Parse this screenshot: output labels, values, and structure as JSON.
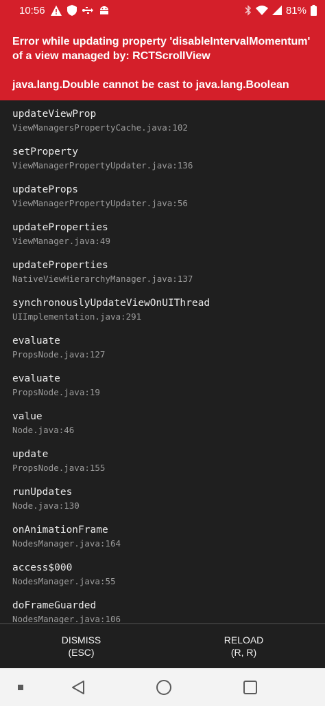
{
  "status_bar": {
    "time": "10:56",
    "battery_percent": "81%",
    "left_icons": [
      "warning-icon",
      "shield-icon",
      "usb-icon",
      "android-debug-icon"
    ],
    "right_icons": [
      "bluetooth-icon",
      "wifi-icon",
      "signal-icon",
      "battery-icon"
    ],
    "background": "#d41f2a"
  },
  "error": {
    "title": "Error while updating property 'disableIntervalMomentum' of a view managed by: RCTScrollView",
    "message": "java.lang.Double cannot be cast to java.lang.Boolean"
  },
  "stack_frames": [
    {
      "method": "updateViewProp",
      "file": "ViewManagersPropertyCache.java:102"
    },
    {
      "method": "setProperty",
      "file": "ViewManagerPropertyUpdater.java:136"
    },
    {
      "method": "updateProps",
      "file": "ViewManagerPropertyUpdater.java:56"
    },
    {
      "method": "updateProperties",
      "file": "ViewManager.java:49"
    },
    {
      "method": "updateProperties",
      "file": "NativeViewHierarchyManager.java:137"
    },
    {
      "method": "synchronouslyUpdateViewOnUIThread",
      "file": "UIImplementation.java:291"
    },
    {
      "method": "evaluate",
      "file": "PropsNode.java:127"
    },
    {
      "method": "evaluate",
      "file": "PropsNode.java:19"
    },
    {
      "method": "value",
      "file": "Node.java:46"
    },
    {
      "method": "update",
      "file": "PropsNode.java:155"
    },
    {
      "method": "runUpdates",
      "file": "Node.java:130"
    },
    {
      "method": "onAnimationFrame",
      "file": "NodesManager.java:164"
    },
    {
      "method": "access$000",
      "file": "NodesManager.java:55"
    },
    {
      "method": "doFrameGuarded",
      "file": "NodesManager.java:106"
    }
  ],
  "buttons": {
    "dismiss_label": "DISMISS",
    "dismiss_shortcut": "(ESC)",
    "reload_label": "RELOAD",
    "reload_shortcut": "(R, R)"
  },
  "nav_bar": {
    "icons": [
      "recents-dot-icon",
      "back-icon",
      "home-icon",
      "overview-icon"
    ]
  }
}
